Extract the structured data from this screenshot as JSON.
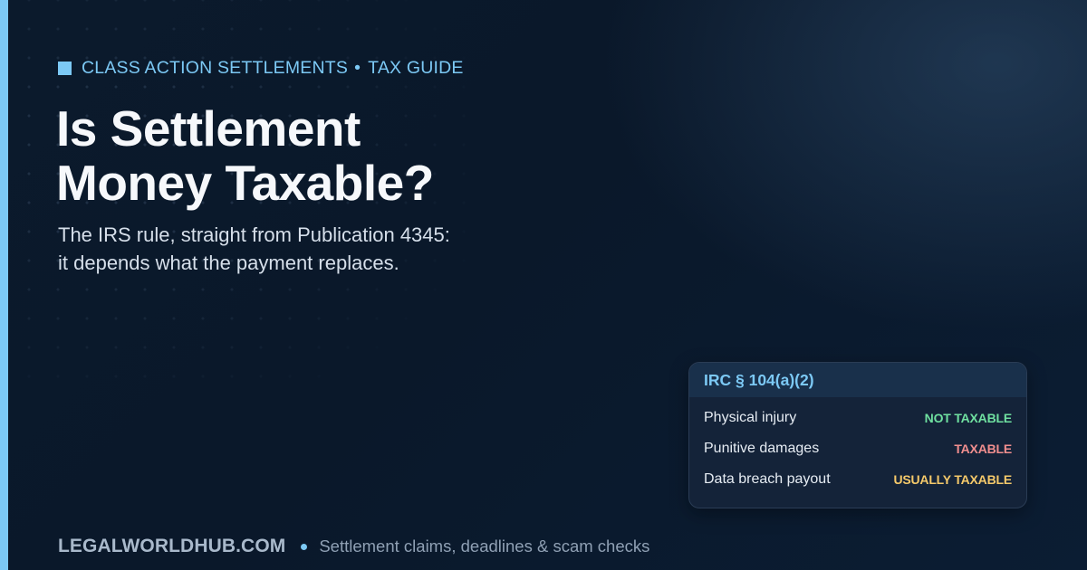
{
  "header": {
    "eyebrow_left": "CLASS ACTION SETTLEMENTS",
    "eyebrow_sep": "•",
    "eyebrow_right": "TAX GUIDE",
    "title_line1": "Is Settlement",
    "title_line2": "Money Taxable?",
    "subtitle_line1": "The IRS rule, straight from Publication 4345:",
    "subtitle_line2": "it depends what the payment replaces."
  },
  "card": {
    "title": "IRC § 104(a)(2)",
    "rows": [
      {
        "label": "Physical injury",
        "status": "NOT TAXABLE",
        "color": "#6fe0a0"
      },
      {
        "label": "Punitive damages",
        "status": "TAXABLE",
        "color": "#f08e8e"
      },
      {
        "label": "Data breach payout",
        "status": "USUALLY TAXABLE",
        "color": "#f5c96a"
      }
    ]
  },
  "footer": {
    "brand": "LEGALWORLDHUB.COM",
    "tagline": "Settlement claims, deadlines & scam checks"
  },
  "colors": {
    "accent": "#7cc9f5",
    "background": "#0b1a2c"
  }
}
